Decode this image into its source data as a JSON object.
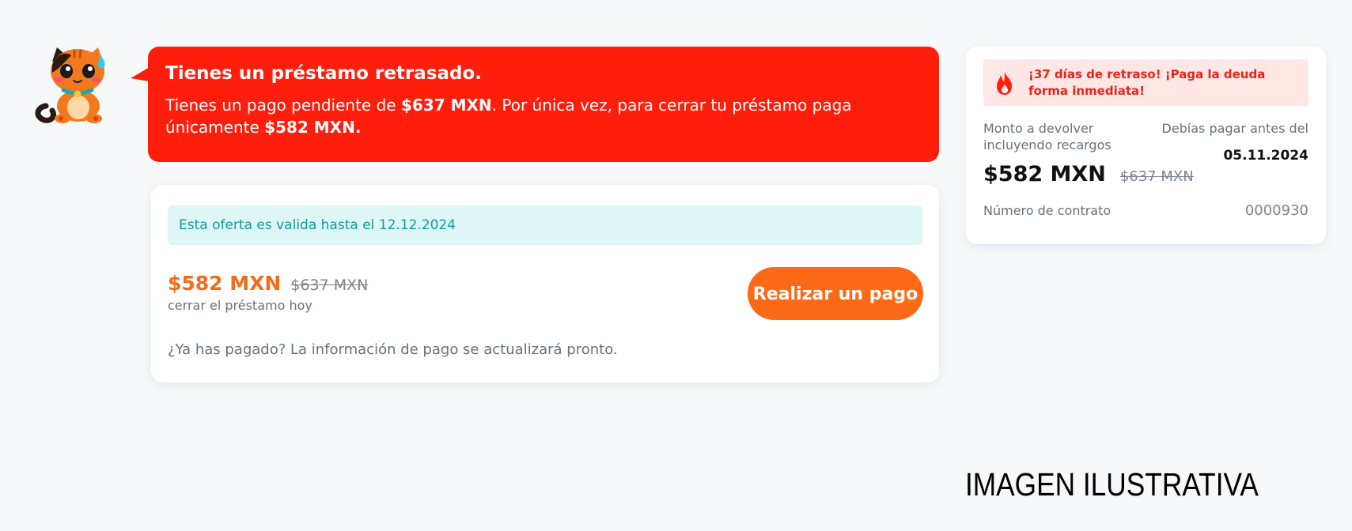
{
  "mascot": {
    "icon": "cat-mascot-icon"
  },
  "notice": {
    "title": "Tienes un préstamo retrasado.",
    "text_part1": "Tienes un pago pendiente de ",
    "amount_pending": "$637 MXN",
    "text_part2": ". Por única vez, para cerrar tu préstamo paga únicamente ",
    "amount_offer": "$582 MXN."
  },
  "offer": {
    "validity": "Esta oferta es valida hasta el 12.12.2024",
    "price": "$582 MXN",
    "old_price": "$637 MXN",
    "subtitle": "cerrar el préstamo hoy",
    "pay_button": "Realizar un pago",
    "footer": "¿Ya has pagado? La información de pago se actualizará pronto."
  },
  "summary": {
    "alert_icon": "flame-icon",
    "alert": "¡37 días de retraso! ¡Paga la deuda forma inmediata!",
    "amount_label": "Monto a devolver incluyendo recargos",
    "due_label": "Debías pagar antes del",
    "due_date": "05.11.2024",
    "price": "$582 MXN",
    "old_price": "$637 MXN",
    "contract_label": "Número de contrato",
    "contract_number": "0000930"
  },
  "caption": "IMAGEN ILUSTRATIVA",
  "colors": {
    "notice_red": "#ff1d0c",
    "accent_orange": "#fd6a17",
    "offer_teal": "#0f9c97",
    "alert_red": "#e8231a",
    "background": "#f7f8fa"
  }
}
